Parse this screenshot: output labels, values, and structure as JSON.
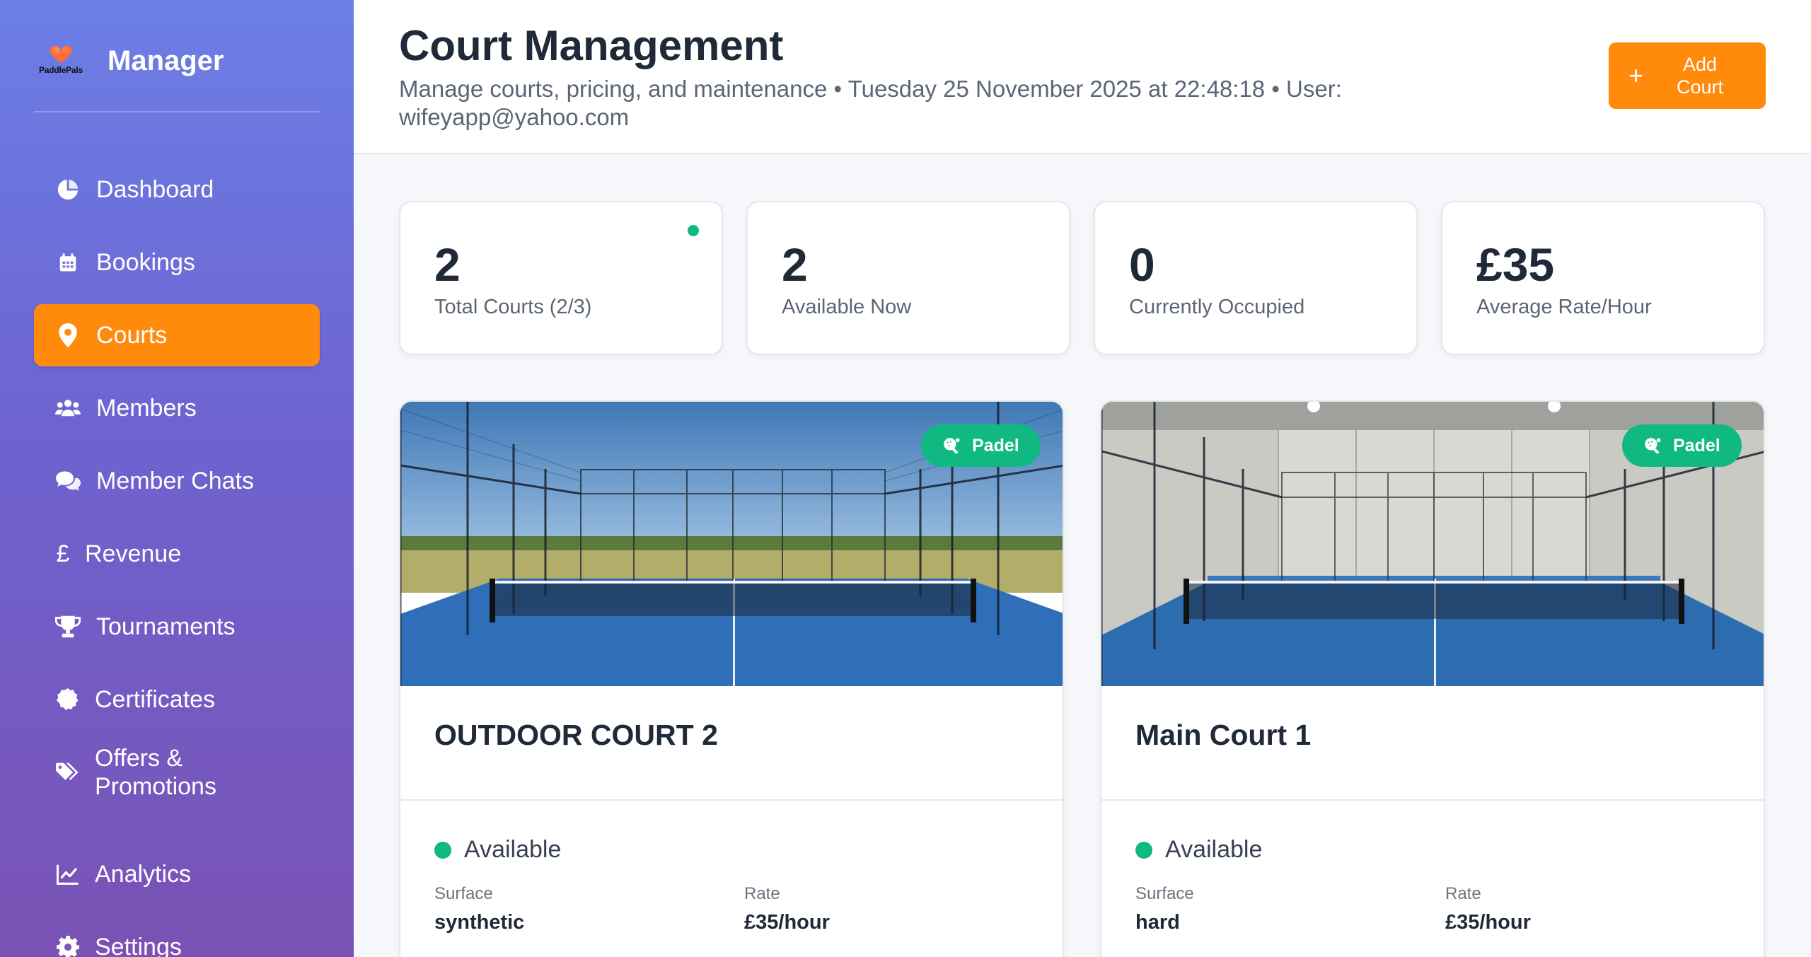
{
  "sidebar": {
    "logo_text": "PaddlePals",
    "title": "Manager",
    "items": [
      {
        "label": "Dashboard",
        "icon": "pie-chart-icon"
      },
      {
        "label": "Bookings",
        "icon": "calendar-icon"
      },
      {
        "label": "Courts",
        "icon": "map-pin-icon",
        "active": true
      },
      {
        "label": "Members",
        "icon": "users-icon"
      },
      {
        "label": "Member Chats",
        "icon": "chat-bubbles-icon"
      },
      {
        "label": "Revenue",
        "icon": "pound-sign-icon"
      },
      {
        "label": "Tournaments",
        "icon": "trophy-icon"
      },
      {
        "label": "Certificates",
        "icon": "certificate-icon"
      },
      {
        "label": "Offers & Promotions",
        "icon": "tags-icon"
      },
      {
        "label": "Analytics",
        "icon": "line-chart-icon"
      },
      {
        "label": "Settings",
        "icon": "gear-icon"
      }
    ]
  },
  "header": {
    "title": "Court Management",
    "subtitle": "Manage courts, pricing, and maintenance • Tuesday 25 November 2025 at 22:48:18 • User: wifeyapp@yahoo.com",
    "add_button": {
      "plus": "+",
      "label": "Add Court"
    }
  },
  "stats": [
    {
      "value": "2",
      "label": "Total Courts (2/3)",
      "indicator": true
    },
    {
      "value": "2",
      "label": "Available Now"
    },
    {
      "value": "0",
      "label": "Currently Occupied"
    },
    {
      "value": "£35",
      "label": "Average Rate/Hour"
    }
  ],
  "courts": [
    {
      "name": "OUTDOOR COURT 2",
      "badge": "Padel",
      "status": "Available",
      "surface_label": "Surface",
      "surface": "synthetic",
      "rate_label": "Rate",
      "rate": "£35/hour",
      "setting": "outdoor"
    },
    {
      "name": "Main Court 1",
      "badge": "Padel",
      "status": "Available",
      "surface_label": "Surface",
      "surface": "hard",
      "rate_label": "Rate",
      "rate": "£35/hour",
      "setting": "indoor"
    }
  ],
  "colors": {
    "accent": "#ff8a0c",
    "success": "#10b981",
    "sidebar_top": "#6b7fe6",
    "sidebar_bottom": "#7a52b4"
  }
}
